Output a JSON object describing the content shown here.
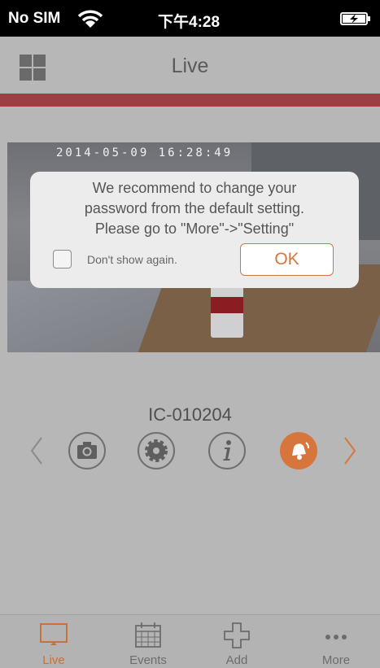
{
  "status_bar": {
    "carrier": "No SIM",
    "time": "下午4:28"
  },
  "nav": {
    "title": "Live"
  },
  "video": {
    "timestamp": "2014-05-09 16:28:49"
  },
  "device": {
    "name": "IC-010204"
  },
  "dialog": {
    "lines": [
      "We recommend to change your",
      "password from the default setting.",
      "Please go to \"More\"->\"Setting\""
    ],
    "checkbox_label": "Don't show again.",
    "ok_label": "OK"
  },
  "tabs": [
    {
      "label": "Live",
      "icon": "monitor-icon",
      "active": true
    },
    {
      "label": "Events",
      "icon": "calendar-icon",
      "active": false
    },
    {
      "label": "Add",
      "icon": "plus-icon",
      "active": false
    },
    {
      "label": "More",
      "icon": "more-dots-icon",
      "active": false
    }
  ],
  "colors": {
    "accent": "#d7763c",
    "redline": "#9c3f44",
    "overlay_bg": "#b7b7b7"
  }
}
